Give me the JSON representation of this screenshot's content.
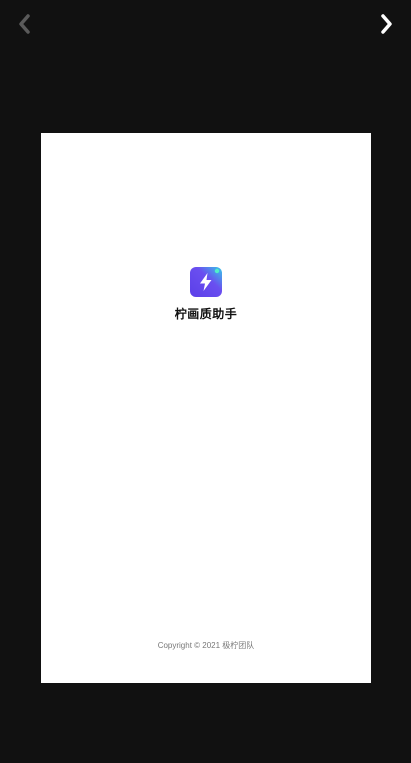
{
  "viewer": {
    "prev_icon": "chevron-left-icon",
    "next_icon": "chevron-right-icon"
  },
  "splash": {
    "app_name": "柠画质助手",
    "logo_icon": "lightning-bolt-icon",
    "copyright": "Copyright © 2021 极柠团队"
  },
  "colors": {
    "background": "#111111",
    "screen": "#ffffff",
    "logo_gradient_start": "#6b3ff0",
    "logo_gradient_end": "#37c6e6",
    "prev_arrow": "#5a5a5a",
    "next_arrow": "#ffffff"
  }
}
